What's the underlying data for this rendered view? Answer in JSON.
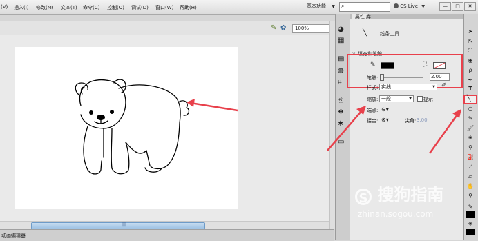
{
  "menu": [
    "(V)",
    "插入(I)",
    "修改(M)",
    "文本(T)",
    "命令(C)",
    "控制(O)",
    "调试(D)",
    "窗口(W)",
    "帮助(H)"
  ],
  "workspace": "基本功能",
  "cs_live": "CS Live",
  "window_controls": [
    "—",
    "□",
    "✕"
  ],
  "zoom": "100%",
  "panel_tabs": {
    "properties": "属性",
    "library": "库"
  },
  "tool_name": "线条工具",
  "section_title": "填充和笔触",
  "stroke_label": "笔触:",
  "stroke_value": "2.00",
  "style_label": "样式:",
  "style_value": "实线",
  "scale_label": "缩放:",
  "scale_value": "一般",
  "hint_label": "提示",
  "cap_label": "端点:",
  "join_label": "接合:",
  "miter_label": "尖角:",
  "miter_value": "3.00",
  "timeline_tab": "动画编辑器",
  "hscroll_marker": "|||",
  "watermark": {
    "brand": "搜狗指南",
    "url": "zhinan.sogou.com"
  },
  "colors": {
    "annotation": "#e8404b",
    "stroke_color": "#000000"
  }
}
